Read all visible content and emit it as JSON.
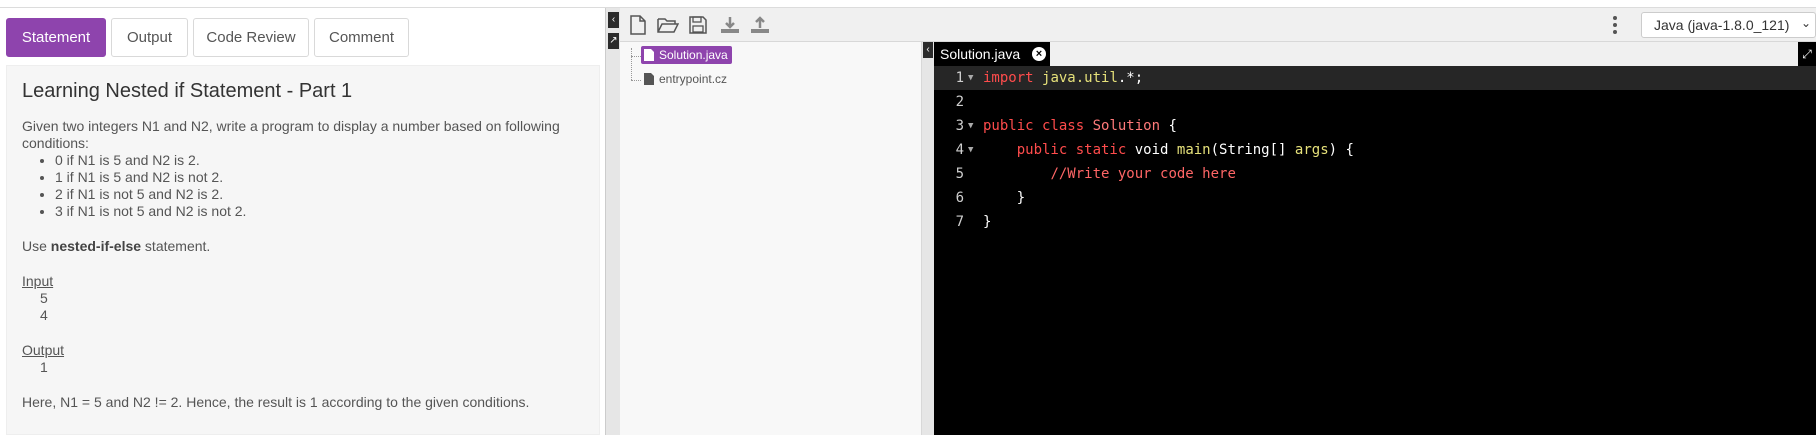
{
  "tabs": [
    {
      "label": "Statement",
      "active": true
    },
    {
      "label": "Output",
      "active": false
    },
    {
      "label": "Code Review",
      "active": false
    },
    {
      "label": "Comment",
      "active": false
    }
  ],
  "statement": {
    "title": "Learning Nested if Statement - Part 1",
    "intro": "Given two integers N1 and N2, write a program to display a number based on following conditions:",
    "conditions": [
      "0 if N1 is 5 and N2 is 2.",
      "1 if N1 is 5 and N2 is not 2.",
      "2 if N1 is not 5 and N2 is 2.",
      "3 if N1 is not 5 and N2 is not 2."
    ],
    "use_prefix": "Use ",
    "use_bold": "nested-if-else",
    "use_suffix": " statement.",
    "input_label": "Input",
    "input_values": [
      "5",
      "4"
    ],
    "output_label": "Output",
    "output_values": [
      "1"
    ],
    "explanation": "Here, N1 = 5 and N2 != 2. Hence, the result is 1 according to the given conditions."
  },
  "toolbar": {
    "icons": [
      "new-file-icon",
      "open-folder-icon",
      "save-icon",
      "download-icon",
      "upload-icon"
    ],
    "language": "Java (java-1.8.0_121)"
  },
  "files": [
    {
      "name": "Solution.java",
      "selected": true
    },
    {
      "name": "entrypoint.cz",
      "selected": false
    }
  ],
  "editor": {
    "tab_label": "Solution.java",
    "lines": [
      {
        "n": "1",
        "fold": true
      },
      {
        "n": "2",
        "fold": false
      },
      {
        "n": "3",
        "fold": true
      },
      {
        "n": "4",
        "fold": true
      },
      {
        "n": "5",
        "fold": false
      },
      {
        "n": "6",
        "fold": false
      },
      {
        "n": "7",
        "fold": false
      }
    ],
    "tokens": {
      "l1_kw": "import",
      "l1_ty": "java.util",
      "l1_rest": ".*;",
      "l3_kw": "public class",
      "l3_name": "Solution",
      "l3_rest": " {",
      "l4_kw": "public static",
      "l4_void": "void",
      "l4_main": "main",
      "l4_args1": "(String[] ",
      "l4_args": "args",
      "l4_rest": ") {",
      "l5_cm": "//Write your code here",
      "l6": "}",
      "l7": "}"
    }
  }
}
